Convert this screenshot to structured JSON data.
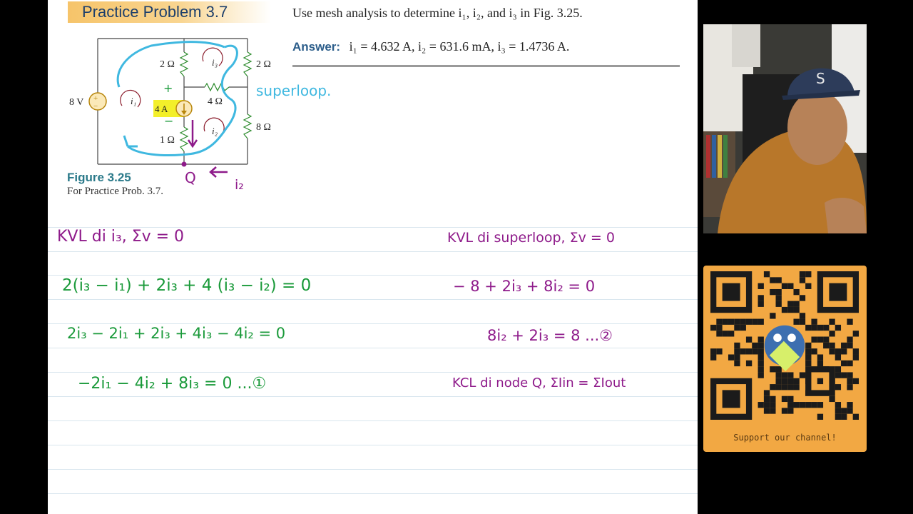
{
  "header": {
    "banner": "Practice Problem 3.7",
    "problem_text": "Use mesh analysis to determine i₁, i₂, and i₃ in Fig. 3.25.",
    "answer_label": "Answer:",
    "answer_text": "i₁ = 4.632 A, i₂ = 631.6 mA, i₃ = 1.4736 A."
  },
  "figure": {
    "title": "Figure 3.25",
    "caption": "For Practice Prob. 3.7.",
    "labels": {
      "v_source": "8 V",
      "r_top_left": "2 Ω",
      "r_top_right": "2 Ω",
      "r_middle": "4 Ω",
      "r_right": "8 Ω",
      "r_bottom": "1 Ω",
      "i_source": "4 A",
      "mesh1": "i₁",
      "mesh2": "i₂",
      "mesh3": "i₃",
      "plus": "+",
      "minus": "−"
    },
    "annotations": {
      "superloop": "superloop.",
      "node_q": "Q",
      "node_current": "i₂",
      "plus_mark": "+",
      "minus_mark": "−"
    }
  },
  "notes": {
    "left": [
      "KVL  di i₃,  Σv = 0",
      "2(i₃ − i₁)  + 2i₃ + 4 (i₃ − i₂) = 0",
      "2i₃ − 2i₁  +  2i₃ + 4i₃ − 4i₂   = 0",
      "−2i₁ − 4i₂  + 8i₃   = 0   ...①"
    ],
    "right": [
      "KVL di superloop, Σv = 0",
      "− 8  + 2i₃  + 8i₂ = 0",
      "8i₂ + 2i₃  = 8   ...②",
      "KCL di node Q, ΣIin = ΣIout"
    ]
  },
  "sidebar": {
    "support_text": "Support our channel!"
  },
  "colors": {
    "green_ink": "#1a9a3a",
    "purple_ink": "#8e1a8a",
    "cyan_ink": "#3fb8e0",
    "qr_background": "#f2a843"
  }
}
